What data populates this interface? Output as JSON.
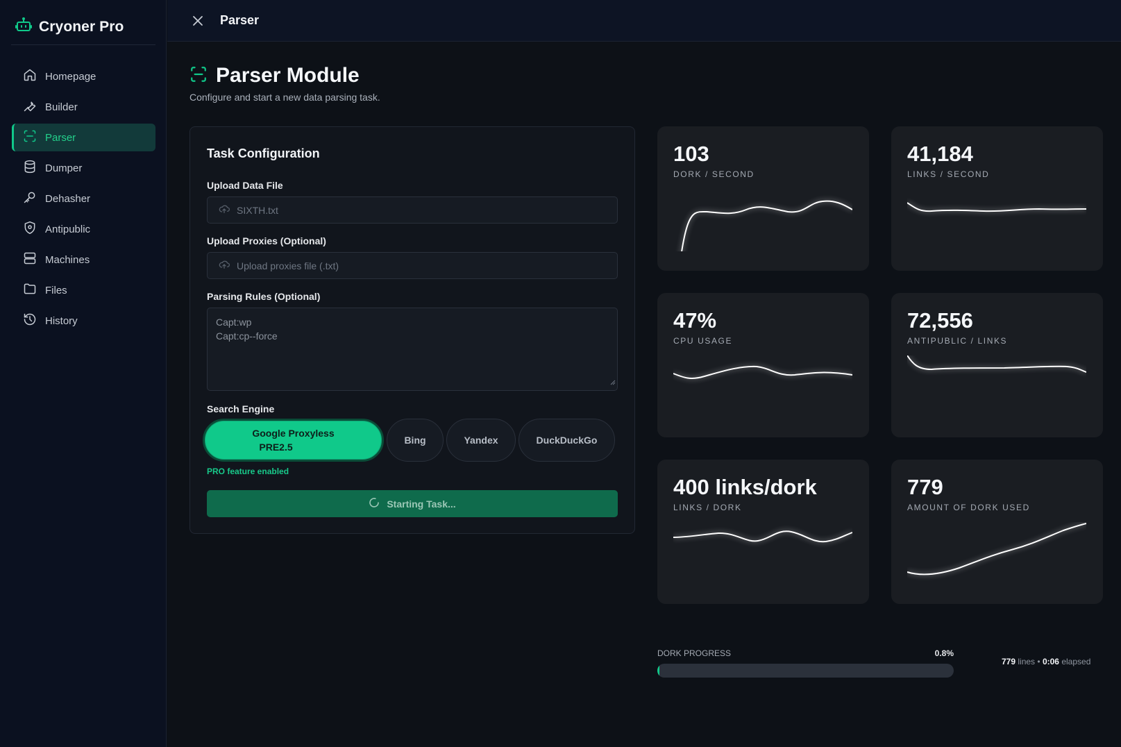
{
  "app": {
    "name": "Cryoner Pro"
  },
  "sidebar": {
    "items": [
      {
        "label": "Homepage",
        "icon": "home-icon",
        "active": false
      },
      {
        "label": "Builder",
        "icon": "wrench-icon",
        "active": false
      },
      {
        "label": "Parser",
        "icon": "scan-icon",
        "active": true
      },
      {
        "label": "Dumper",
        "icon": "database-icon",
        "active": false
      },
      {
        "label": "Dehasher",
        "icon": "key-icon",
        "active": false
      },
      {
        "label": "Antipublic",
        "icon": "shield-icon",
        "active": false
      },
      {
        "label": "Machines",
        "icon": "server-icon",
        "active": false
      },
      {
        "label": "Files",
        "icon": "folder-icon",
        "active": false
      },
      {
        "label": "History",
        "icon": "history-icon",
        "active": false
      }
    ]
  },
  "topbar": {
    "title": "Parser"
  },
  "page": {
    "title": "Parser Module",
    "subtitle": "Configure and start a new data parsing task."
  },
  "config": {
    "title": "Task Configuration",
    "data_file": {
      "label": "Upload Data File",
      "value": "SIXTH.txt"
    },
    "proxies": {
      "label": "Upload Proxies (Optional)",
      "placeholder": "Upload proxies file (.txt)"
    },
    "rules": {
      "label": "Parsing Rules (Optional)",
      "lines": [
        "Capt:wp",
        "Capt:cp--force"
      ]
    },
    "engine": {
      "label": "Search Engine",
      "options": [
        {
          "label_line1": "Google Proxyless",
          "label_line2": "PRE2.5",
          "selected": true
        },
        {
          "label": "Bing",
          "selected": false
        },
        {
          "label": "Yandex",
          "selected": false
        },
        {
          "label": "DuckDuckGo",
          "selected": false
        }
      ]
    },
    "pro_note": "PRO feature enabled",
    "start_button": "Starting Task..."
  },
  "stats": [
    {
      "value": "103",
      "label": "DORK / SECOND"
    },
    {
      "value": "41,184",
      "label": "LINKS / SECOND"
    },
    {
      "value": "47%",
      "label": "CPU USAGE"
    },
    {
      "value": "72,556",
      "label": "ANTIPUBLIC / LINKS"
    },
    {
      "value": "400 links/dork",
      "label": "LINKS / DORK"
    },
    {
      "value": "779",
      "label": "AMOUNT OF DORK USED"
    }
  ],
  "progress": {
    "label": "DORK PROGRESS",
    "percent_text": "0.8%",
    "percent": 0.8,
    "lines_value": "779",
    "lines_unit": "lines",
    "elapsed_value": "0:06",
    "elapsed_unit": "elapsed"
  },
  "colors": {
    "accent": "#10c98a",
    "background": "#0d1117",
    "sidebar": "#0b1120",
    "card": "#1a1d22"
  }
}
